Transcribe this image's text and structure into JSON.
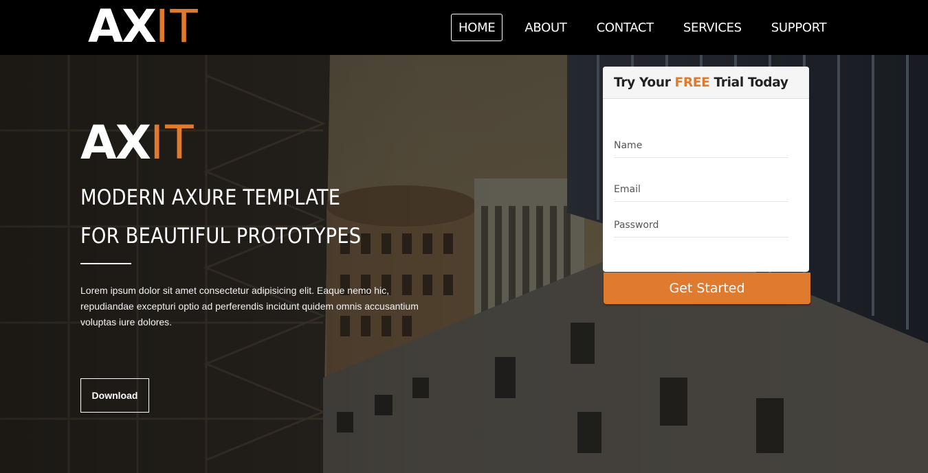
{
  "brand": {
    "logo_main": "AX",
    "logo_accent": "IT"
  },
  "nav": {
    "items": [
      {
        "label": "HOME",
        "active": true
      },
      {
        "label": "ABOUT",
        "active": false
      },
      {
        "label": "CONTACT",
        "active": false
      },
      {
        "label": "SERVICES",
        "active": false
      },
      {
        "label": "SUPPORT",
        "active": false
      }
    ]
  },
  "hero": {
    "logo_main": "AX",
    "logo_accent": "IT",
    "headline_line1": "MODERN AXURE TEMPLATE",
    "headline_line2": "FOR BEAUTIFUL PROTOTYPES",
    "lead": "Lorem ipsum dolor sit amet consectetur adipisicing elit. Eaque nemo hic, repudiandae excepturi optio ad perferendis incidunt quidem omnis accusantium voluptas iure dolores.",
    "download_label": "Download"
  },
  "signup": {
    "title_before": "Try Your",
    "title_accent": "FREE",
    "title_after": "Trial Today",
    "name_placeholder": "Name",
    "email_placeholder": "Email",
    "password_placeholder": "Password",
    "submit_label": "Get Started"
  },
  "colors": {
    "accent": "#e07a2e",
    "navbar": "#000000",
    "card": "#ffffff"
  }
}
